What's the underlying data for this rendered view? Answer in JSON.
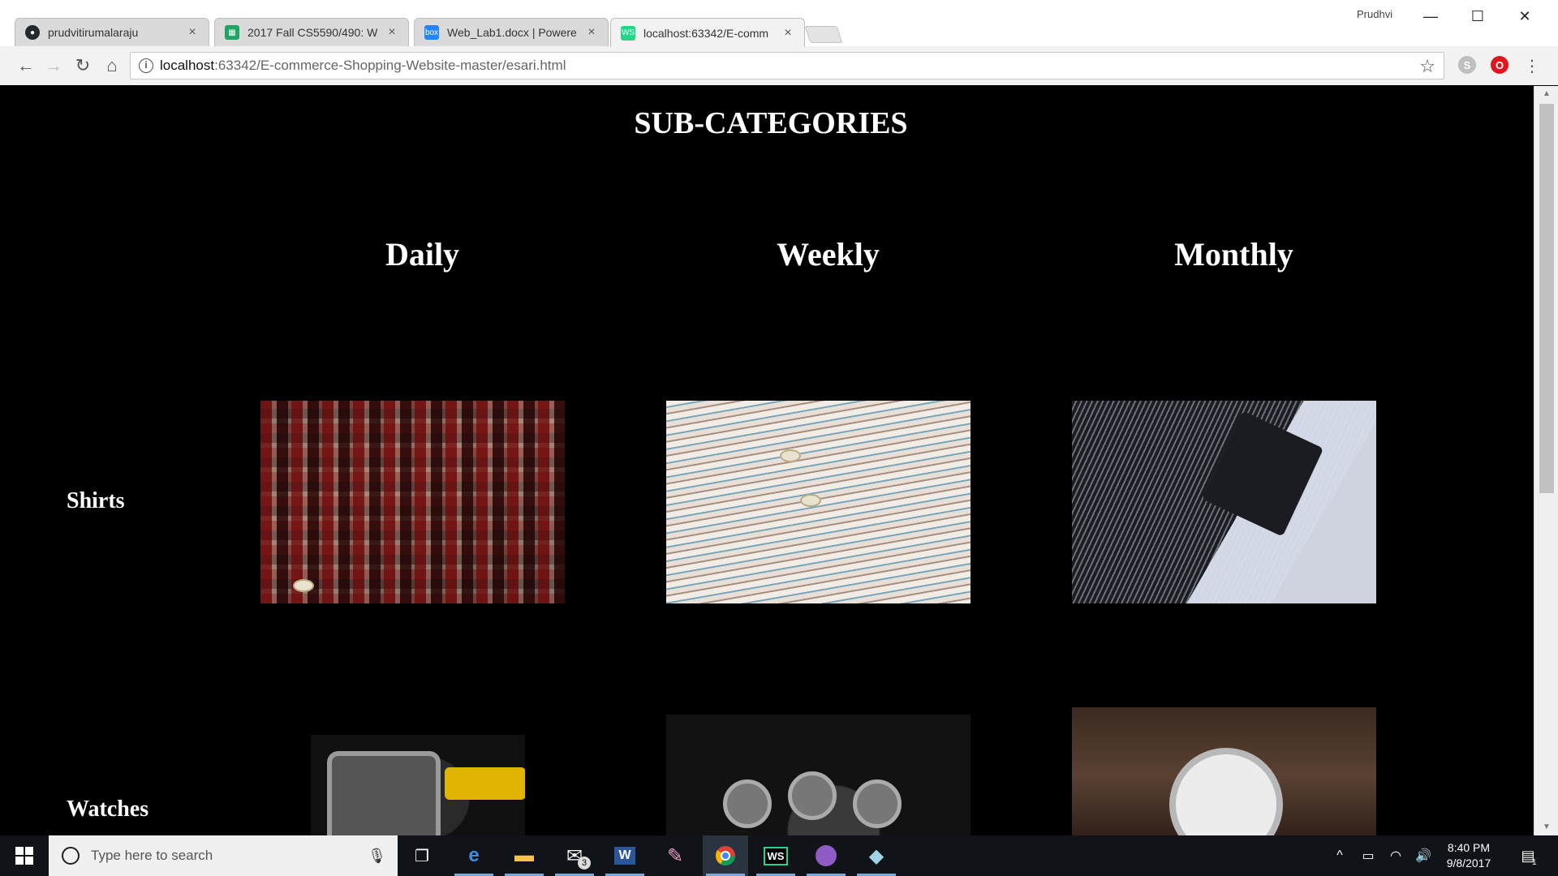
{
  "browser": {
    "tabs": [
      {
        "title": "prudvitirumalaraju",
        "icon": "github-icon",
        "active": false
      },
      {
        "title": "2017 Fall CS5590/490: W",
        "icon": "sheets-icon",
        "active": false
      },
      {
        "title": "Web_Lab1.docx | Powere",
        "icon": "box-icon",
        "active": false
      },
      {
        "title": "localhost:63342/E-comm",
        "icon": "webstorm-icon",
        "active": true
      }
    ],
    "profile_name": "Prudhvi",
    "url_host": "localhost",
    "url_rest": ":63342/E-commerce-Shopping-Website-master/esari.html"
  },
  "page": {
    "title": "SUB-CATEGORIES",
    "columns": [
      "Daily",
      "Weekly",
      "Monthly"
    ],
    "rows": [
      {
        "label": "Shirts",
        "images": [
          "plaid-shirt-image",
          "striped-shirt-image",
          "dark-shirt-image"
        ]
      },
      {
        "label": "Watches",
        "images": [
          "chronograph-watch-image",
          "multi-dial-watch-image",
          "leather-watch-image"
        ]
      }
    ]
  },
  "taskbar": {
    "search_placeholder": "Type here to search",
    "mail_badge": "3",
    "time": "8:40 PM",
    "date": "9/8/2017",
    "notification_count": "1"
  }
}
